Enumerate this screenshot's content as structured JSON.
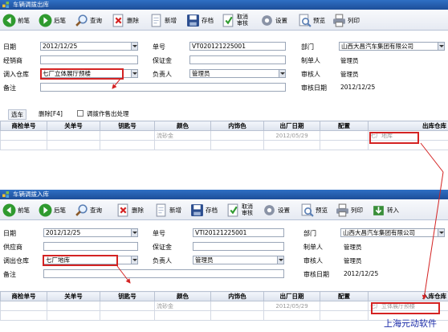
{
  "win1": {
    "title": "车辆调拨出库",
    "toolbar": [
      "前笔",
      "后笔",
      "查询",
      "删除",
      "新增",
      "存档",
      "取消",
      "审核",
      "设置",
      "预览",
      "列印"
    ],
    "fields": {
      "date_label": "日期",
      "date_value": "2012/12/25",
      "no_label": "单号",
      "no_value": "VT020121225001",
      "dept_label": "部门",
      "dept_value": "山西大昌汽车集团有限公司",
      "dealer_label": "经销商",
      "cert_label": "保证金",
      "maker_label": "制单人",
      "maker_value": "管理员",
      "wh_label": "调入仓库",
      "wh_value": "七厂立体展厅预楼",
      "resp_label": "负责人",
      "resp_value": "管理员",
      "auditor_label": "审核人",
      "auditor_value": "管理员",
      "remark_label": "备注",
      "audit_date_label": "审核日期",
      "audit_date_value": "2012/12/25"
    },
    "subbar": {
      "select_car": "选车",
      "delete": "删除[F4]",
      "checkbox": "调拨作售出处理"
    },
    "columns": [
      "商检单号",
      "关单号",
      "钥匙号",
      "颜色",
      "内饰色",
      "出厂日期",
      "配置",
      "出库仓库"
    ],
    "rows": [
      [
        "",
        "",
        "",
        "流砂金",
        "",
        "2012/05/29",
        "",
        "七厂地库"
      ],
      [
        "",
        "",
        "",
        "",
        "",
        "",
        "",
        ""
      ]
    ]
  },
  "win2": {
    "title": "车辆调拨入库",
    "toolbar": [
      "前笔",
      "后笔",
      "查询",
      "删除",
      "新增",
      "存档",
      "取消",
      "审核",
      "设置",
      "预览",
      "列印",
      "转入"
    ],
    "fields": {
      "date_label": "日期",
      "date_value": "2012/12/25",
      "no_label": "单号",
      "no_value": "VTI20121225001",
      "dept_label": "部门",
      "dept_value": "山西大昌汽车集团有限公司",
      "supplier_label": "供应商",
      "cert_label": "保证金",
      "maker_label": "制单人",
      "maker_value": "管理员",
      "wh_label": "调出仓库",
      "wh_value": "七厂地库",
      "resp_label": "负责人",
      "resp_value": "管理员",
      "auditor_label": "审核人",
      "auditor_value": "管理员",
      "remark_label": "备注",
      "audit_date_label": "审核日期",
      "audit_date_value": "2012/12/25"
    },
    "columns": [
      "商检单号",
      "关单号",
      "钥匙号",
      "颜色",
      "内饰色",
      "出厂日期",
      "配置",
      "入库仓库"
    ],
    "rows": [
      [
        "",
        "",
        "",
        "流砂金",
        "",
        "2012/05/29",
        "",
        "七厂立体展厅预楼"
      ],
      [
        "",
        "",
        "",
        "",
        "",
        "",
        "",
        ""
      ]
    ]
  },
  "watermark": "上海元动软件",
  "colors": {
    "highlight": "#d42323",
    "titlebar": "#2f6fc4"
  }
}
